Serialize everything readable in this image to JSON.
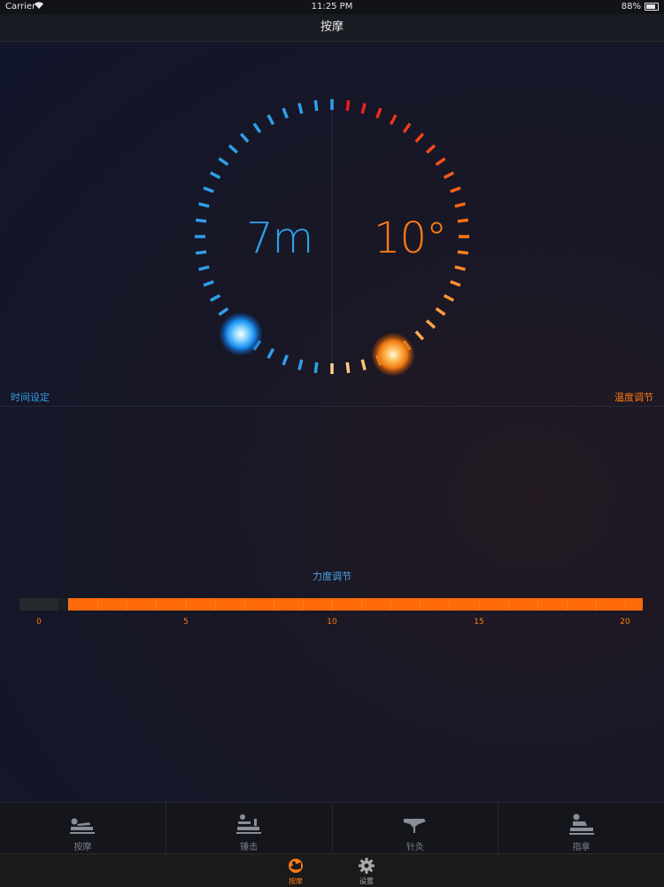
{
  "status_bar": {
    "carrier": "Carrier",
    "time": "11:25 PM",
    "battery": "88%"
  },
  "nav": {
    "title": "按摩"
  },
  "dial": {
    "time_value": "7m",
    "temp_value": "10°",
    "time_label": "时间设定",
    "temp_label": "温度调节",
    "time_color": "#2f9fe8",
    "temp_color": "#ff7a14",
    "hot_color": "#e8131f"
  },
  "force": {
    "label": "力度调节",
    "min": 0,
    "max": 20,
    "value": 1,
    "tick_labels": [
      "0",
      "5",
      "10",
      "15",
      "20"
    ],
    "fill_color": "#ff6a0a"
  },
  "modes": [
    {
      "label": "按摩",
      "icon": "massage-lying-icon"
    },
    {
      "label": "锤击",
      "icon": "hammer-massage-icon"
    },
    {
      "label": "针灸",
      "icon": "acupuncture-icon"
    },
    {
      "label": "指拿",
      "icon": "finger-press-icon"
    }
  ],
  "tabs": [
    {
      "label": "按摩",
      "icon": "massage-tab-icon",
      "active": true
    },
    {
      "label": "设置",
      "icon": "gear-icon",
      "active": false
    }
  ]
}
